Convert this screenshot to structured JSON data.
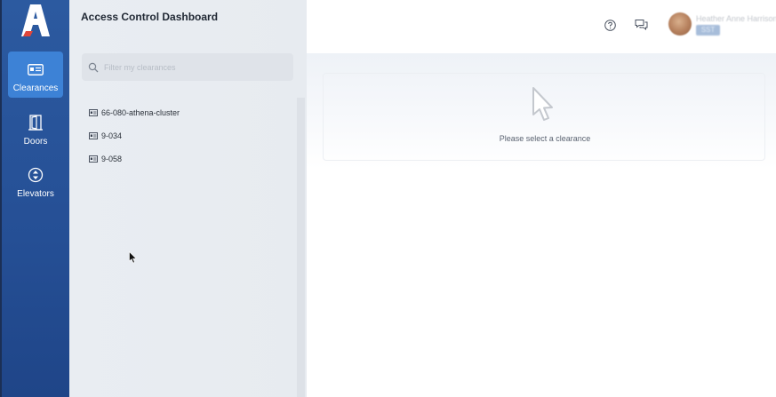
{
  "nav": {
    "items": [
      {
        "label": "Clearances",
        "icon": "id-card-icon",
        "active": true
      },
      {
        "label": "Doors",
        "icon": "door-icon",
        "active": false
      },
      {
        "label": "Elevators",
        "icon": "elevator-icon",
        "active": false
      }
    ]
  },
  "panel": {
    "title": "Access Control Dashboard",
    "search_placeholder": "Filter my clearances",
    "clearances": [
      {
        "label": "66-080-athena-cluster"
      },
      {
        "label": "9-034"
      },
      {
        "label": "9-058"
      }
    ]
  },
  "header": {
    "user_name": "Heather Anne Harrison",
    "user_tag": "SST"
  },
  "main": {
    "empty_message": "Please select a clearance"
  },
  "colors": {
    "rail": "#2c5aa0",
    "rail_active": "#3d82d6",
    "panel": "#e9edf2",
    "text": "#1f2733"
  }
}
